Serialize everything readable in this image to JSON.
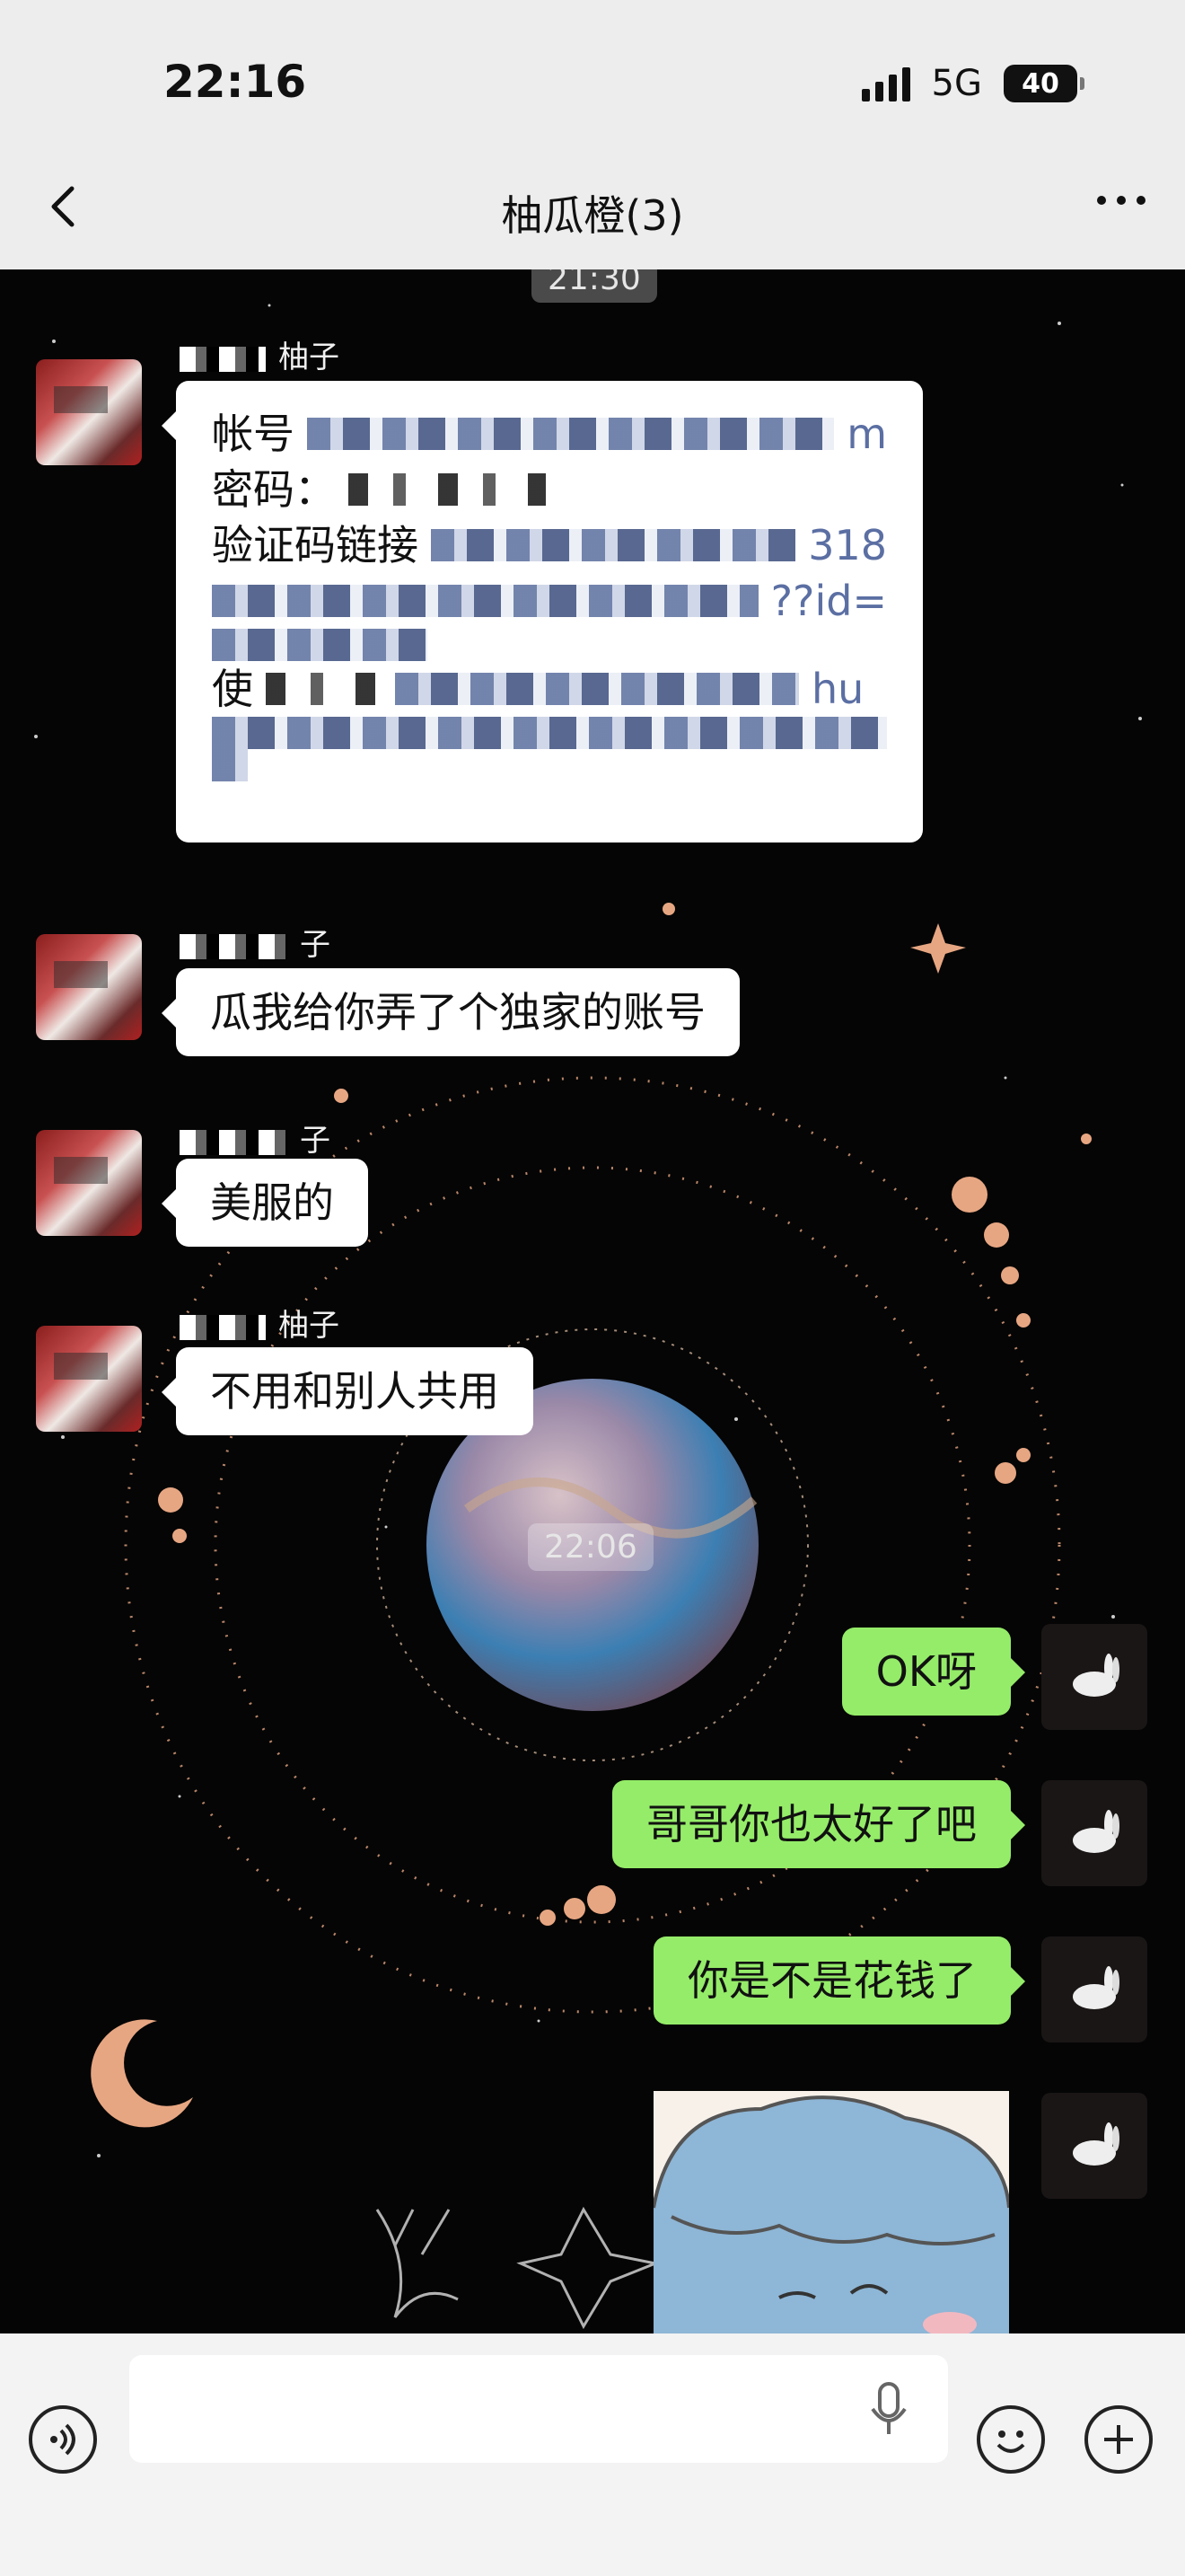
{
  "status": {
    "time": "22:16",
    "network": "5G",
    "battery": "40"
  },
  "nav": {
    "title": "柚瓜橙(3)"
  },
  "timestamps": {
    "first": "21:30",
    "second": "22:06"
  },
  "messages": {
    "sender_name": "柚子",
    "sender_name_partial": "子",
    "account": {
      "line1": "帐号",
      "line2": "密码：",
      "line3": "验证码链接",
      "frag_318": "318",
      "frag_id": "??id=",
      "frag_m": "m",
      "line5": "使",
      "frag_hu": "hu"
    },
    "left": [
      "瓜我给你弄了个独家的账号",
      "美服的",
      "不用和别人共用"
    ],
    "right": [
      "OK呀",
      "哥哥你也太好了吧",
      "你是不是花钱了"
    ]
  },
  "icons": [
    "back-icon",
    "more-icon",
    "voice-icon",
    "mic-icon",
    "emoji-icon",
    "plus-icon"
  ]
}
